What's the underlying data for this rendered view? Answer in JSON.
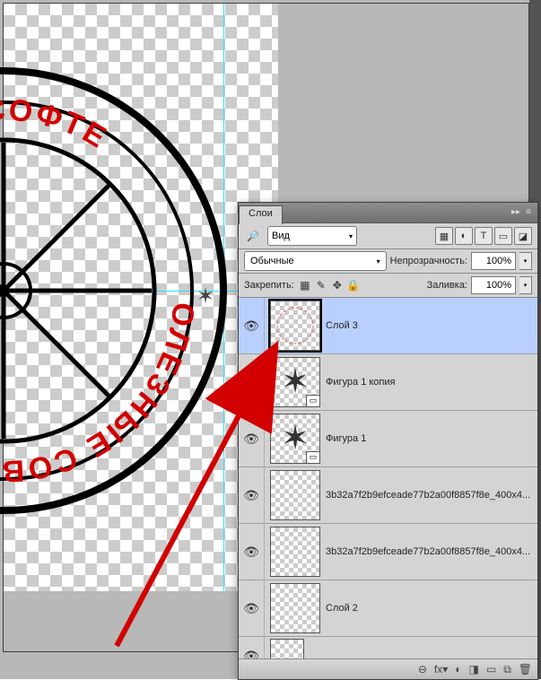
{
  "panel": {
    "title": "Слои",
    "filter": {
      "kind_label": "Вид"
    },
    "blend_mode": "Обычные",
    "opacity_label": "Непрозрачность:",
    "opacity_value": "100%",
    "lock_label": "Закрепить:",
    "fill_label": "Заливка:",
    "fill_value": "100%"
  },
  "filter_icons": [
    "▦",
    "◐",
    "T",
    "▭",
    "◪"
  ],
  "lock_icons": [
    "▦",
    "✎",
    "✥",
    "🔒"
  ],
  "layers": [
    {
      "name": "Слой 3",
      "selected": true,
      "visible": true,
      "thumb": "circle",
      "badge": ""
    },
    {
      "name": "Фигура 1 копия",
      "selected": false,
      "visible": true,
      "thumb": "star",
      "badge": "▭"
    },
    {
      "name": "Фигура 1",
      "selected": false,
      "visible": true,
      "thumb": "star",
      "badge": "▭"
    },
    {
      "name": "3b32a7f2b9efceade77b2a00f8857f8e_400x4...",
      "selected": false,
      "visible": true,
      "thumb": "blank",
      "badge": ""
    },
    {
      "name": "3b32a7f2b9efceade77b2a00f8857f8e_400x4...",
      "selected": false,
      "visible": true,
      "thumb": "blank",
      "badge": ""
    },
    {
      "name": "Слой 2",
      "selected": false,
      "visible": true,
      "thumb": "blank",
      "badge": ""
    }
  ],
  "bottom_icons": [
    "⊖",
    "fx▾",
    "◐",
    "◨",
    "▭",
    "⧉",
    "🗑"
  ],
  "canvas": {
    "text_top": "ШИЙ САЙТ О СОФТЕ",
    "text_bottom": "ОЛЕЗНЫЕ СОВЕТЫ"
  },
  "annotation": {
    "arrow_color": "#d20000"
  }
}
